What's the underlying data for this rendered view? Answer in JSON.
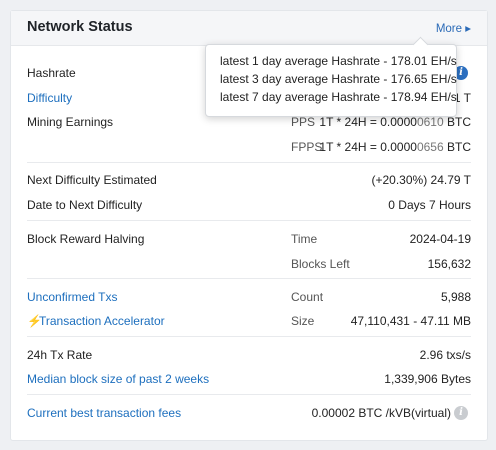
{
  "header": {
    "title": "Network Status",
    "more": "More ▸"
  },
  "hashrate": {
    "label": "Hashrate",
    "tooltip": [
      "latest 1 day average Hashrate - 178.01 EH/s",
      "latest 3 day average Hashrate - 176.65 EH/s",
      "latest 7 day average Hashrate - 178.94 EH/s"
    ]
  },
  "difficulty": {
    "label": "Difficulty",
    "value": "61 T"
  },
  "mining": {
    "label": "Mining Earnings",
    "pps_label": "PPS",
    "pps_prefix": "1T * 24H = 0.0000",
    "pps_tail": "0610",
    "pps_unit": " BTC",
    "fpps_label": "FPPS",
    "fpps_prefix": "1T * 24H = 0.0000",
    "fpps_tail": "0656",
    "fpps_unit": " BTC"
  },
  "next_difficulty": {
    "label": "Next Difficulty Estimated",
    "value": "(+20.30%) 24.79 T"
  },
  "date_next": {
    "label": "Date to Next Difficulty",
    "value": "0 Days 7 Hours"
  },
  "halving": {
    "label": "Block Reward Halving",
    "time_label": "Time",
    "time_value": "2024-04-19",
    "left_label": "Blocks Left",
    "left_value": "156,632"
  },
  "unconfirmed": {
    "label": "Unconfirmed Txs",
    "count_label": "Count",
    "count_value": "5,988"
  },
  "accelerator": {
    "label": "Transaction Accelerator",
    "size_label": "Size",
    "size_value": "47,110,431 - 47.11 MB"
  },
  "tx_rate": {
    "label": "24h Tx Rate",
    "value": "2.96 txs/s"
  },
  "median_block": {
    "label": "Median block size of past 2 weeks",
    "value": "1,339,906 Bytes"
  },
  "best_fees": {
    "label": "Current best transaction fees",
    "value": "0.00002 BTC /kVB(virtual)"
  },
  "colors": {
    "link": "#1d6fbe",
    "info": "#2b6fc0"
  }
}
